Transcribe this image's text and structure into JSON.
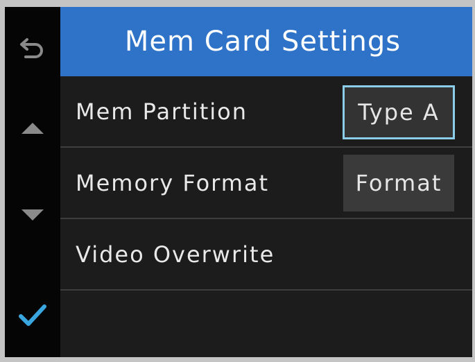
{
  "header": {
    "title": "Mem Card Settings"
  },
  "sidebar": {
    "back_icon": "back-arrow-icon",
    "up_icon": "triangle-up-icon",
    "down_icon": "triangle-down-icon",
    "confirm_icon": "checkmark-icon"
  },
  "rows": [
    {
      "label": "Mem Partition",
      "value": "Type A",
      "selected": true
    },
    {
      "label": "Memory Format",
      "value": "Format",
      "selected": false
    },
    {
      "label": "Video Overwrite",
      "value": "",
      "selected": false
    }
  ],
  "colors": {
    "header": "#2f73c9",
    "accent": "#3aa6e0",
    "selection_border": "#8ccde9",
    "background": "#1c1c1c"
  }
}
